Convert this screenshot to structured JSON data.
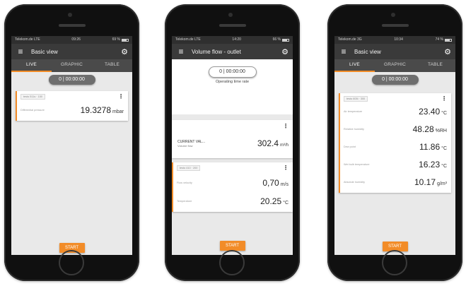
{
  "colors": {
    "accent": "#f28c28",
    "appbar": "#3a3a3a",
    "tabbar": "#4a4a4a",
    "screen_bg": "#e9e9e9"
  },
  "phones": [
    {
      "status": {
        "carrier": "Telekom.de LTE",
        "time": "09:26",
        "battery": "69 %"
      },
      "appbar": {
        "menu_icon": "hamburger-icon",
        "title": "Basic view",
        "settings_icon": "gear-icon"
      },
      "tabs": [
        "LIVE",
        "GRAPHIC",
        "TABLE"
      ],
      "active_tab": 0,
      "timer": "0 | 00:00:00",
      "card": {
        "chip": "testo 511s · 150",
        "measure_label": "Differential pressure",
        "value": "19.3278",
        "unit": "mbar"
      },
      "start_label": "START"
    },
    {
      "status": {
        "carrier": "Telekom.de LTE",
        "time": "14:20",
        "battery": "66 %"
      },
      "appbar": {
        "menu_icon": "hamburger-icon",
        "title": "Volume flow - outlet",
        "settings_icon": "gear-icon"
      },
      "timer": "0 | 00:00:00",
      "subtitle": "Operating time rate",
      "volume_card": {
        "label": "CURRENT VAL...",
        "sub": "Volume flow",
        "value": "302.4",
        "unit": "m³/h"
      },
      "card": {
        "chip": "testo 410 · 200",
        "rows": [
          {
            "label": "Flow velocity",
            "value": "0,70",
            "unit": "m/s"
          },
          {
            "label": "Temperature",
            "value": "20.25",
            "unit": "°C"
          }
        ]
      },
      "start_label": "START"
    },
    {
      "status": {
        "carrier": "Telekom.de 3G",
        "time": "10:34",
        "battery": "74 %"
      },
      "appbar": {
        "menu_icon": "hamburger-icon",
        "title": "Basic view",
        "settings_icon": "gear-icon"
      },
      "tabs": [
        "LIVE",
        "GRAPHIC",
        "TABLE"
      ],
      "active_tab": 0,
      "timer": "0 | 00:00:00",
      "card": {
        "chip": "testo 605i · 300",
        "rows": [
          {
            "label": "Air temperature",
            "value": "23.40",
            "unit": "°C"
          },
          {
            "label": "Relative humidity",
            "value": "48.28",
            "unit": "%RH"
          },
          {
            "label": "Dew point",
            "value": "11.86",
            "unit": "°C"
          },
          {
            "label": "Wet bulb temperature",
            "value": "16.23",
            "unit": "°C"
          },
          {
            "label": "Absolute humidity",
            "value": "10.17",
            "unit": "g/m³"
          }
        ]
      },
      "start_label": "START"
    }
  ]
}
